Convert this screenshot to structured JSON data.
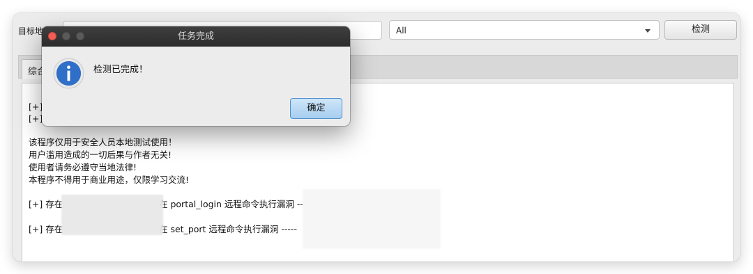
{
  "toolbar": {
    "target_label": "目标地",
    "target_value": "",
    "vuln_select_value": "All",
    "check_button_label": "检测"
  },
  "tabs": [
    {
      "label": "综合"
    }
  ],
  "output": {
    "lines": [
      "[+]",
      "[+]",
      "该程序仅用于安全人员本地测试使用！",
      "用户滥用造成的一切后果与作者无关!",
      "使用者请务必遵守当地法律!",
      "本程序不得用于商业用途，仅限学习交流!",
      "[+] 存在",
      "在 portal_login 远程命令执行漏洞 --",
      "[+] 存在",
      "在 set_port 远程命令执行漏洞 -----"
    ]
  },
  "dialog": {
    "title": "任务完成",
    "message": "检测已完成！",
    "ok_label": "确定",
    "icon": "info-icon",
    "colors": {
      "icon_blue": "#2f6fc7",
      "titlebar": "#333333",
      "close": "#f05f57"
    }
  }
}
